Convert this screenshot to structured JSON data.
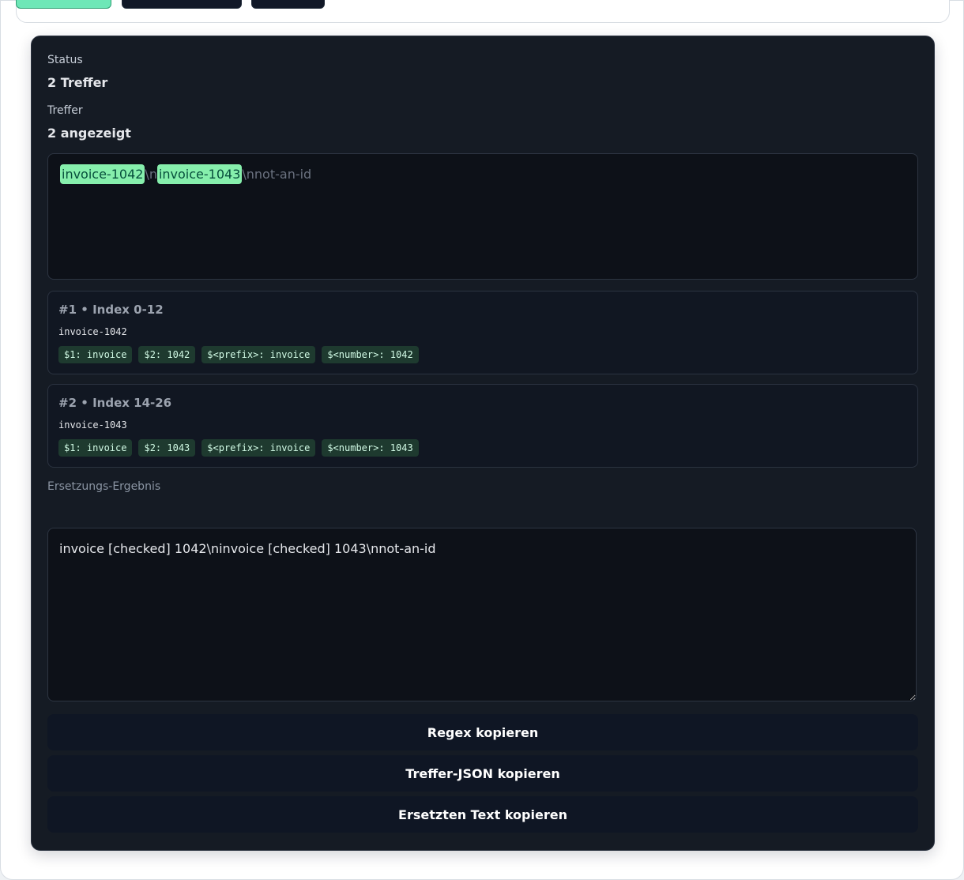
{
  "summary": {
    "status_label": "Status",
    "status_value": "2 Treffer",
    "matches_label": "Treffer",
    "matches_value": "2 angezeigt"
  },
  "highlighted_text": {
    "match_1": "invoice-1042",
    "sep_1": "\\n",
    "match_2": "invoice-1043",
    "tail": "\\nnot-an-id"
  },
  "matches": [
    {
      "number": "#1",
      "separator": "•",
      "index": "Index 0-12",
      "text": "invoice-1042",
      "groups": [
        "$1: invoice",
        "$2: 1042",
        "$<prefix>: invoice",
        "$<number>: 1042"
      ]
    },
    {
      "number": "#2",
      "separator": "•",
      "index": "Index 14-26",
      "text": "invoice-1043",
      "groups": [
        "$1: invoice",
        "$2: 1043",
        "$<prefix>: invoice",
        "$<number>: 1043"
      ]
    }
  ],
  "replacement": {
    "label": "Ersetzungs-Ergebnis",
    "sub_label": "",
    "result": "invoice [checked] 1042\\ninvoice [checked] 1043\\nnot-an-id"
  },
  "actions": {
    "copy_regex": "Regex kopieren",
    "copy_json": "Treffer-JSON kopieren",
    "copy_replaced": "Ersetzten Text kopieren"
  },
  "colors": {
    "panel_background": "#151b24",
    "highlight": "#86efac",
    "group_chip": "#1e3a2f",
    "accent_button": "#6ee7b7"
  }
}
